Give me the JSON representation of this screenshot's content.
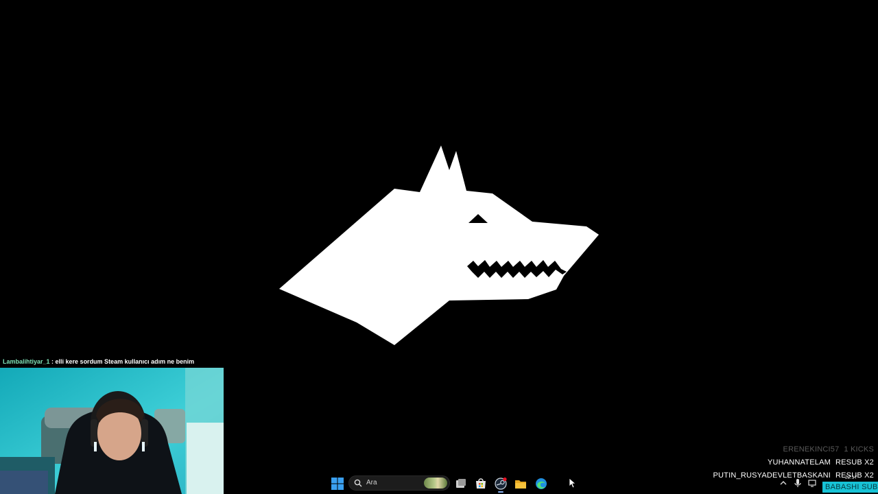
{
  "chat": {
    "username": "Lambalihtiyar_1",
    "separator": " : ",
    "message": "elli kere sordum Steam kullanıcı adım ne benim"
  },
  "alerts": [
    {
      "user": "ERENEKINCI57",
      "action": "1 KICKS",
      "faded": true
    },
    {
      "user": "YUHANNATELAM",
      "action": "RESUB X2",
      "faded": false
    },
    {
      "user": "PUTIN_RUSYADEVLETBASKANI",
      "action": "RESUB X2",
      "faded": false
    }
  ],
  "badge": {
    "text": "BABASHI SUB"
  },
  "taskbar": {
    "search_placeholder": "Ara",
    "icons": [
      "start-icon",
      "search-icon",
      "task-view-icon",
      "microsoft-store-icon",
      "steam-icon",
      "file-explorer-icon",
      "edge-icon"
    ]
  },
  "tray": {
    "icons": [
      "chevron-up-icon",
      "microphone-icon",
      "display-icon"
    ],
    "clock_partial": "22:17"
  },
  "colors": {
    "background": "#000000",
    "logo": "#ffffff",
    "badge_bg": "#17c3d6",
    "chat_username": "#7fe3b8",
    "taskbar_active": "#8ab4f8"
  },
  "splash": {
    "icon": "wolf-head-logo"
  }
}
